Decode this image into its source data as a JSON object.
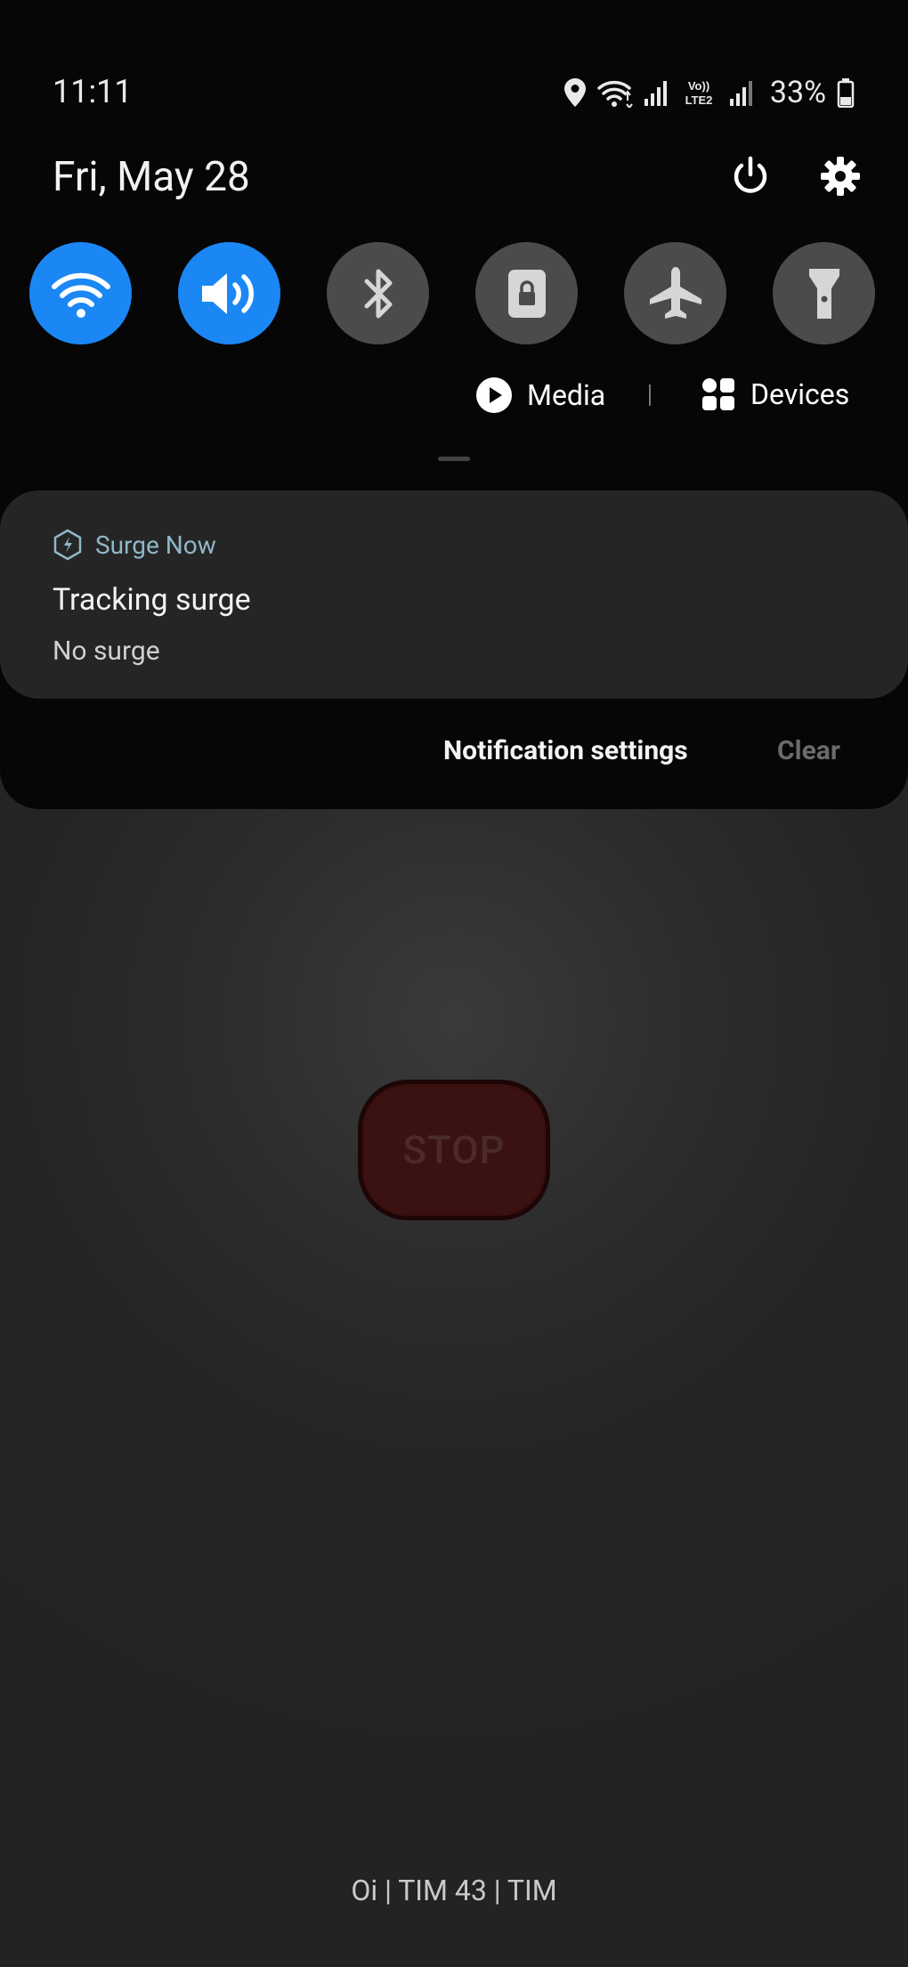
{
  "status_bar": {
    "time": "11:11",
    "battery_percent": "33%",
    "network_label": "Vo)) LTE2"
  },
  "date": "Fri, May 28",
  "quick_settings": [
    {
      "name": "wifi",
      "icon": "wifi-icon",
      "state": "on"
    },
    {
      "name": "sound",
      "icon": "volume-icon",
      "state": "on"
    },
    {
      "name": "bluetooth",
      "icon": "bluetooth-icon",
      "state": "off"
    },
    {
      "name": "portrait-lock",
      "icon": "rotation-lock-icon",
      "state": "off"
    },
    {
      "name": "airplane-mode",
      "icon": "airplane-icon",
      "state": "off"
    },
    {
      "name": "flashlight",
      "icon": "flashlight-icon",
      "state": "off"
    }
  ],
  "media_label": "Media",
  "devices_label": "Devices",
  "notification": {
    "app_name": "Surge Now",
    "title": "Tracking surge",
    "text": "No surge"
  },
  "footer": {
    "settings_label": "Notification settings",
    "clear_label": "Clear"
  },
  "background_app": {
    "stop_label": "STOP",
    "carrier_text": "Oi | TIM 43 | TIM"
  },
  "colors": {
    "accent": "#1a87f5",
    "tile_off": "#4b4b4b",
    "shade_bg": "#060606",
    "card_bg": "#252525",
    "app_name": "#8fb7c9"
  }
}
